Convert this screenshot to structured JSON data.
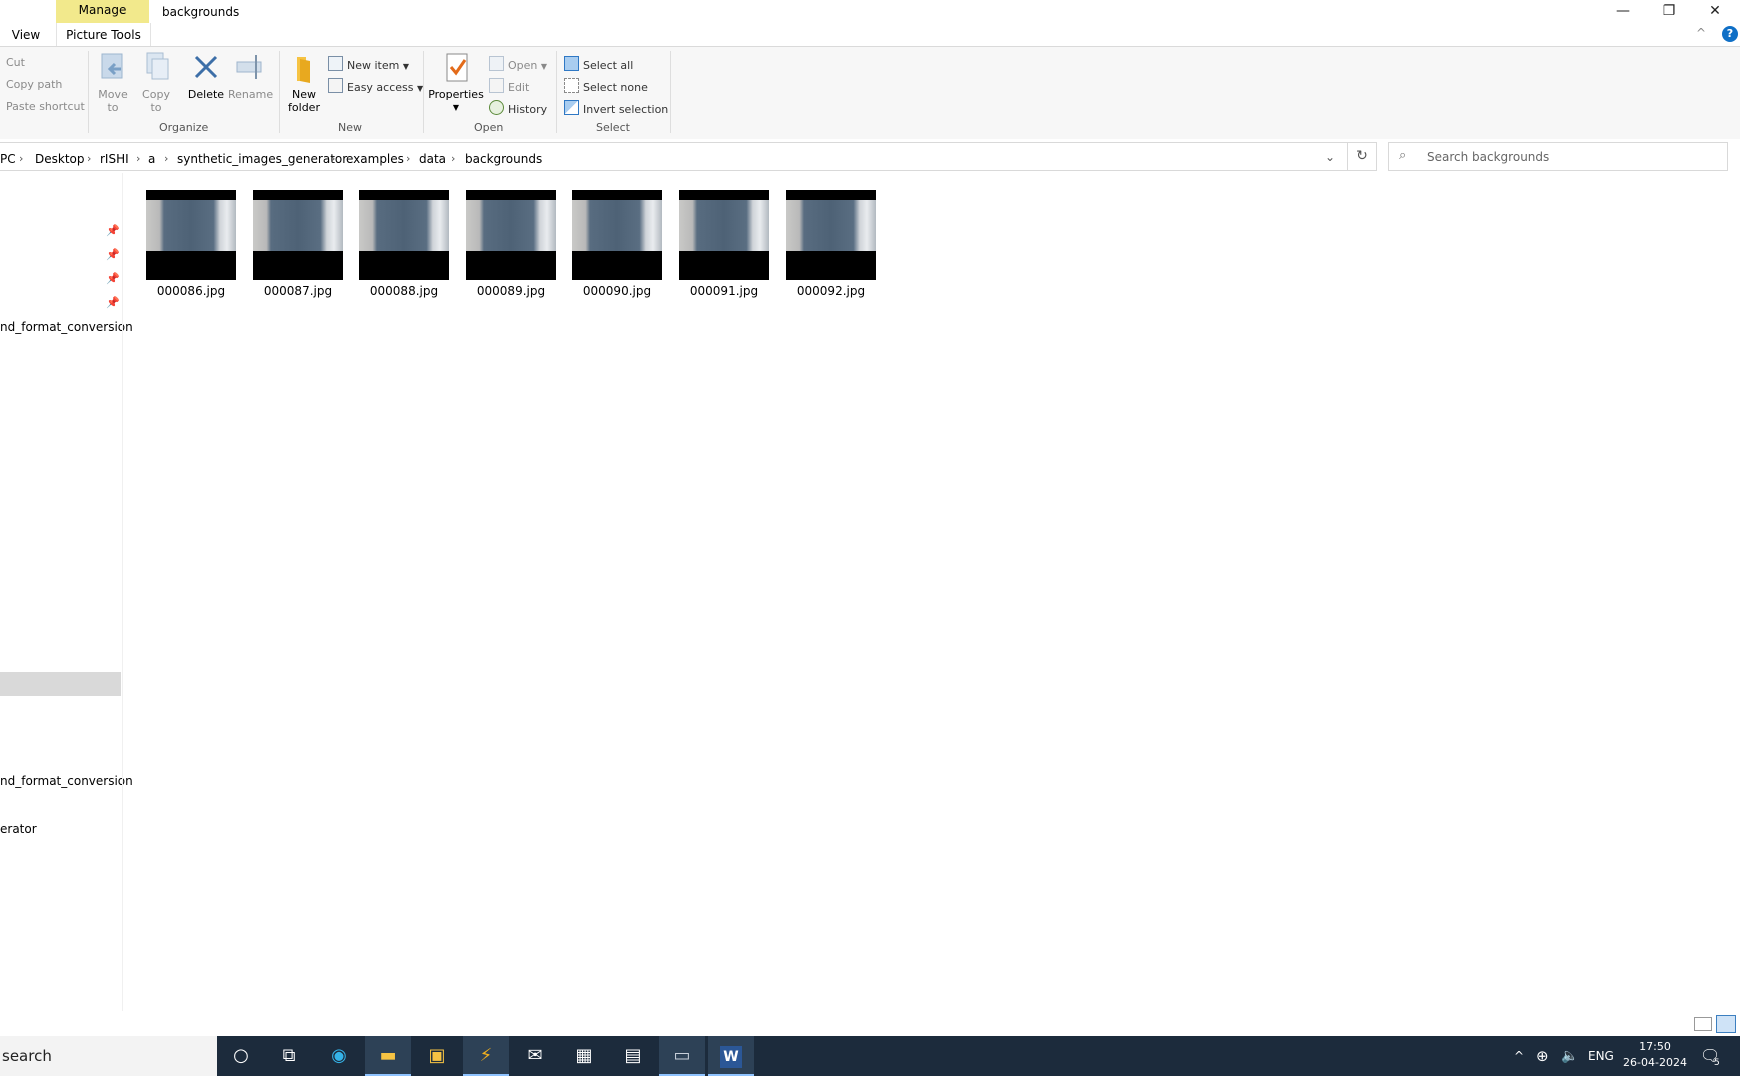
{
  "window": {
    "title": "backgrounds",
    "manage_tab": "Manage",
    "picture_tools_tab": "Picture Tools",
    "view_tab": "View",
    "minimize": "—",
    "restore": "❐",
    "close": "✕",
    "help": "?",
    "collapse": "^"
  },
  "ribbon": {
    "clipboard": {
      "cut": "Cut",
      "copy_path": "Copy path",
      "paste_shortcut": "Paste shortcut"
    },
    "organize": {
      "move_to_1": "Move",
      "move_to_2": "to",
      "copy_to_1": "Copy",
      "copy_to_2": "to",
      "delete": "Delete",
      "rename": "Rename",
      "group": "Organize"
    },
    "new": {
      "new_folder_1": "New",
      "new_folder_2": "folder",
      "new_item": "New item",
      "easy_access": "Easy access",
      "group": "New"
    },
    "open": {
      "properties": "Properties",
      "open": "Open",
      "edit": "Edit",
      "history": "History",
      "group": "Open"
    },
    "select": {
      "select_all": "Select all",
      "select_none": "Select none",
      "invert_selection": "Invert selection",
      "group": "Select"
    }
  },
  "address": {
    "crumbs": [
      "PC",
      "Desktop",
      "rISHI",
      "a",
      "synthetic_images_generator",
      "examples",
      "data",
      "backgrounds"
    ],
    "search_placeholder": "Search backgrounds"
  },
  "nav": {
    "item_1": "nd_format_conversion",
    "item_2": "nd_format_conversion",
    "item_3": "erator"
  },
  "files": [
    {
      "name": "000086.jpg"
    },
    {
      "name": "000087.jpg"
    },
    {
      "name": "000088.jpg"
    },
    {
      "name": "000089.jpg"
    },
    {
      "name": "000090.jpg"
    },
    {
      "name": "000091.jpg"
    },
    {
      "name": "000092.jpg"
    }
  ],
  "taskbar": {
    "search_text": "search",
    "language": "ENG",
    "time": "17:50",
    "date": "26-04-2024",
    "notification_count": "5"
  },
  "colors": {
    "manage_tab": "#f2e98c",
    "taskbar": "#1c2b3c",
    "accent": "#0f6fc6"
  }
}
